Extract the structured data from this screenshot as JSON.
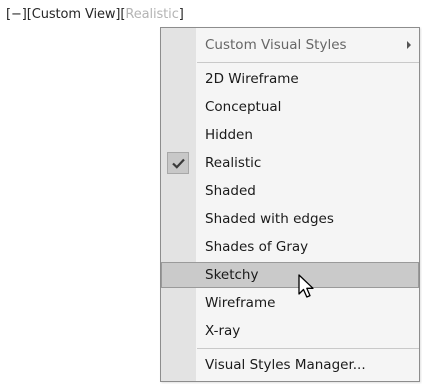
{
  "viewport_label": {
    "minus": "[−]",
    "view": "[Custom View]",
    "open_bracket": "[",
    "style": "Realistic",
    "close_bracket": "]"
  },
  "menu": {
    "submenu_item": "Custom Visual Styles",
    "items": [
      "2D Wireframe",
      "Conceptual",
      "Hidden",
      "Realistic",
      "Shaded",
      "Shaded with edges",
      "Shades of Gray",
      "Sketchy",
      "Wireframe",
      "X-ray"
    ],
    "checked_item": "Realistic",
    "highlighted_item": "Sketchy",
    "manager_item": "Visual Styles Manager..."
  },
  "icons": {
    "check": "check-icon",
    "submenu": "chevron-right-icon",
    "cursor": "mouse-pointer-icon"
  }
}
